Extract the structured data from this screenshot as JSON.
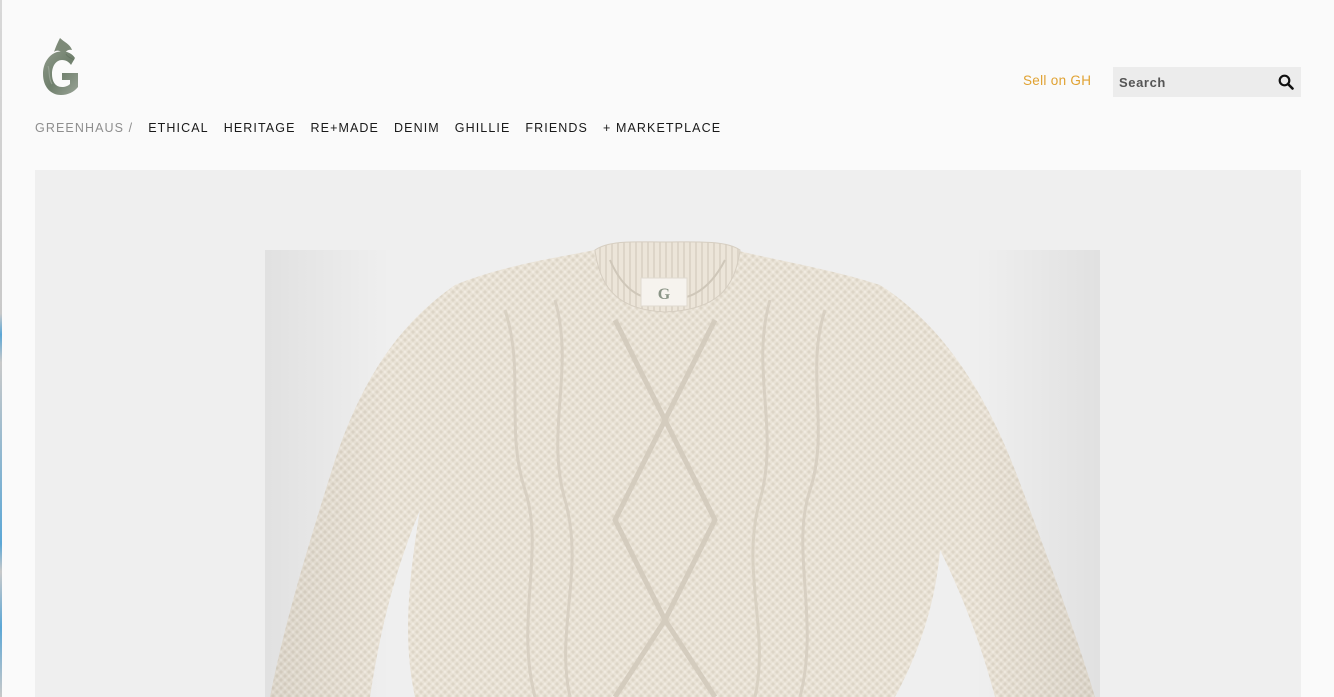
{
  "header": {
    "logo_icon": "greenhaus-g-logo-icon",
    "sell_label": "Sell on GH",
    "sell_color": "#e0a232"
  },
  "search": {
    "placeholder": "Search",
    "value": "",
    "icon": "search-icon"
  },
  "nav": {
    "brand": "GREENHAUS /",
    "items": [
      {
        "label": "ETHICAL"
      },
      {
        "label": "HERITAGE"
      },
      {
        "label": "RE+MADE"
      },
      {
        "label": "DENIM"
      },
      {
        "label": "GHILLIE"
      },
      {
        "label": "FRIENDS"
      },
      {
        "label": "+ MARKETPLACE"
      }
    ]
  },
  "hero": {
    "image": "cream-cable-knit-sweater-photo",
    "background": "#efefef",
    "sweater_color": "#eae3d7",
    "label_logo": "G"
  }
}
